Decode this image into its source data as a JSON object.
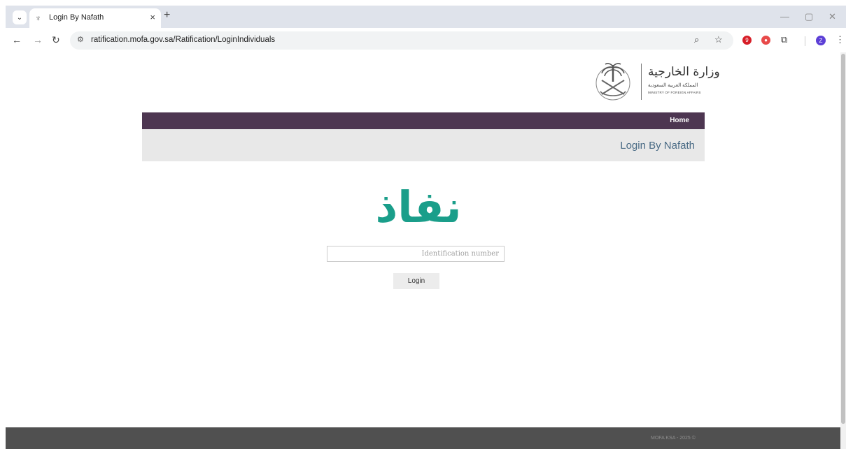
{
  "browser": {
    "tab_title": "Login By Nafath",
    "tab_close": "×",
    "new_tab": "+",
    "url": "ratification.mofa.gov.sa/Ratification/LoginIndividuals",
    "avatar_letter": "Z",
    "ext_red_1": "9",
    "window": {
      "minimize": "—",
      "restore": "▢",
      "close": "✕"
    }
  },
  "header": {
    "logo_ar_title": "وزارة الخارجية",
    "logo_ar_sub": "المملكة العربية السعودية",
    "logo_en": "MINISTRY OF FOREIGN AFFAIRS"
  },
  "nav": {
    "home_label": "Home"
  },
  "page": {
    "title": "Login By Nafath"
  },
  "nafath": {
    "logo_text": "نفاذ",
    "logo_color": "#1a9e8a"
  },
  "form": {
    "id_placeholder": "Identification number",
    "id_value": "",
    "login_label": "Login"
  },
  "footer": {
    "text": "MOFA KSA - 2025 ©"
  },
  "colors": {
    "navbar": "#4d3651",
    "pagehead": "#e8e8e8",
    "title": "#4a6b85",
    "footer": "#505050"
  }
}
